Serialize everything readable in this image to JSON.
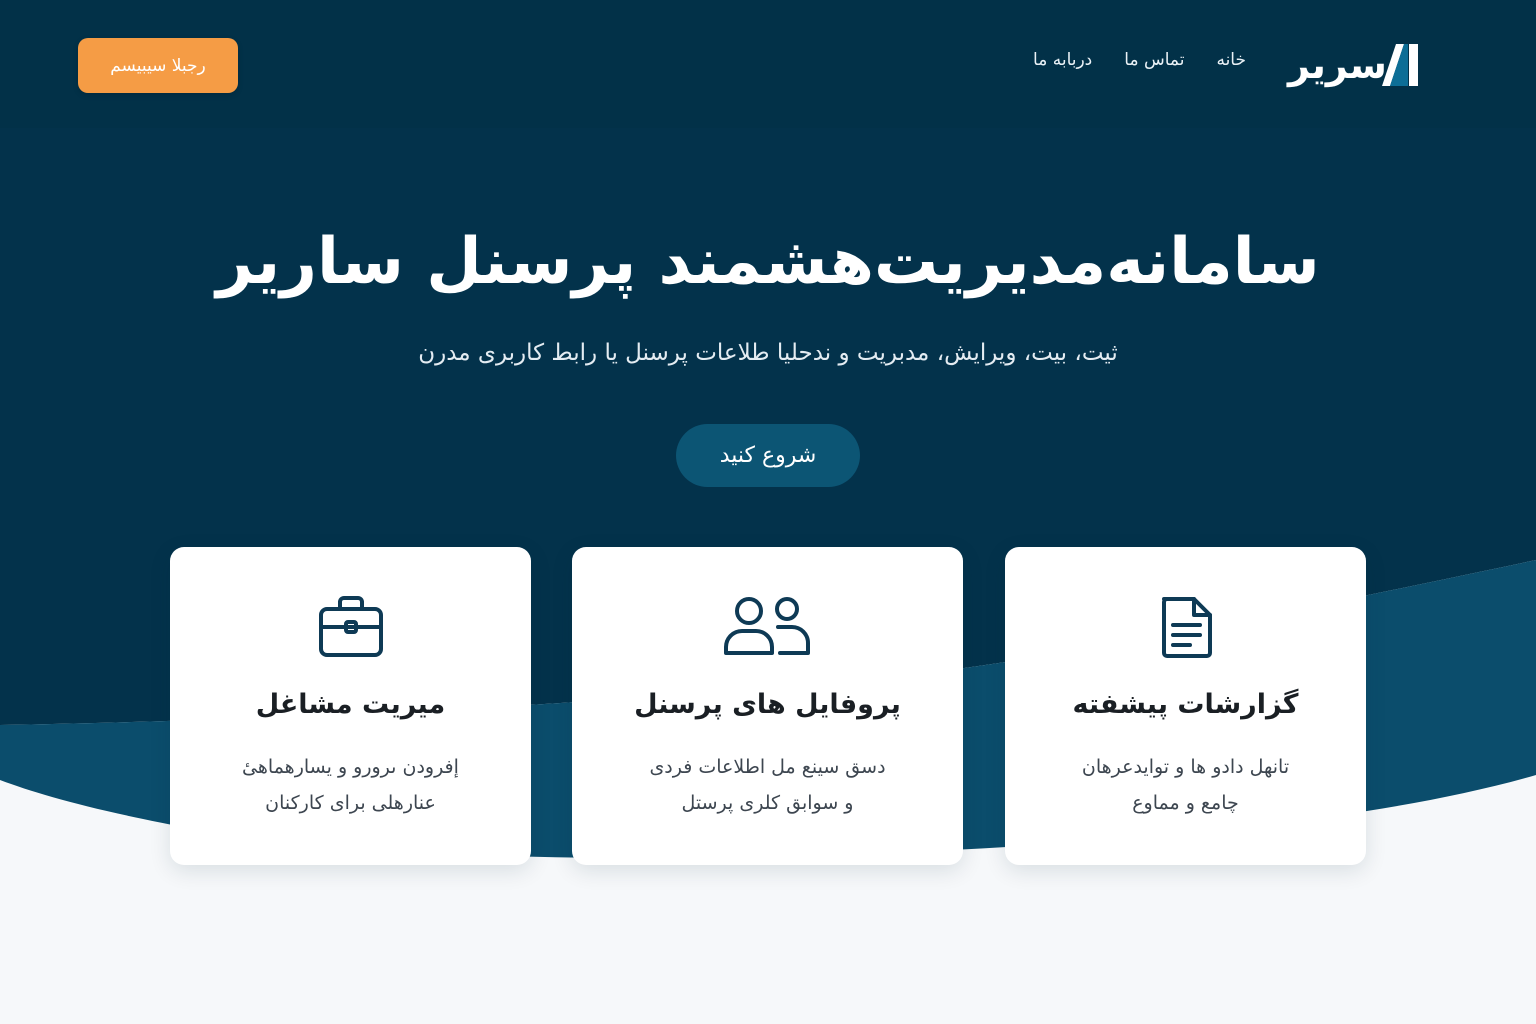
{
  "header": {
    "cta_label": "رجبلا سیبیسم",
    "brand": "سریر",
    "nav": [
      "خانه",
      "تماس ما",
      "دربابه ما"
    ]
  },
  "hero": {
    "title": "سامانه‌مدیریت‌هشمند پرسنل ساریر",
    "subtitle": "ثیت، بیت، ویرایش، مدبریت و ندحلیا طلاعات پرسنل یا رابط کاربری مدرن",
    "button": "شروع کنید"
  },
  "cards": [
    {
      "icon": "briefcase-icon",
      "title": "میریت مشاغل",
      "desc": [
        "إفرودن ىرورو و یسارهماهیٔ",
        "عنارهلی برای کارکنان"
      ]
    },
    {
      "icon": "users-icon",
      "title": "پروفایل های پرسنل",
      "desc": [
        "دسق سینع مل اطلاعات فردی",
        "و سوابق کلری پرستل"
      ]
    },
    {
      "icon": "document-icon",
      "title": "گزارشات پیشفته",
      "desc": [
        "تانهل دادو ها و تواید‌عرهان",
        "چامع و مماوع"
      ]
    }
  ],
  "colors": {
    "header_bg": "#023148",
    "hero_bg": "#03324b",
    "wave": "#0b4d6c",
    "accent_orange": "#f59c45",
    "hero_button": "#0c5574",
    "icon_stroke": "#0e3a55"
  }
}
